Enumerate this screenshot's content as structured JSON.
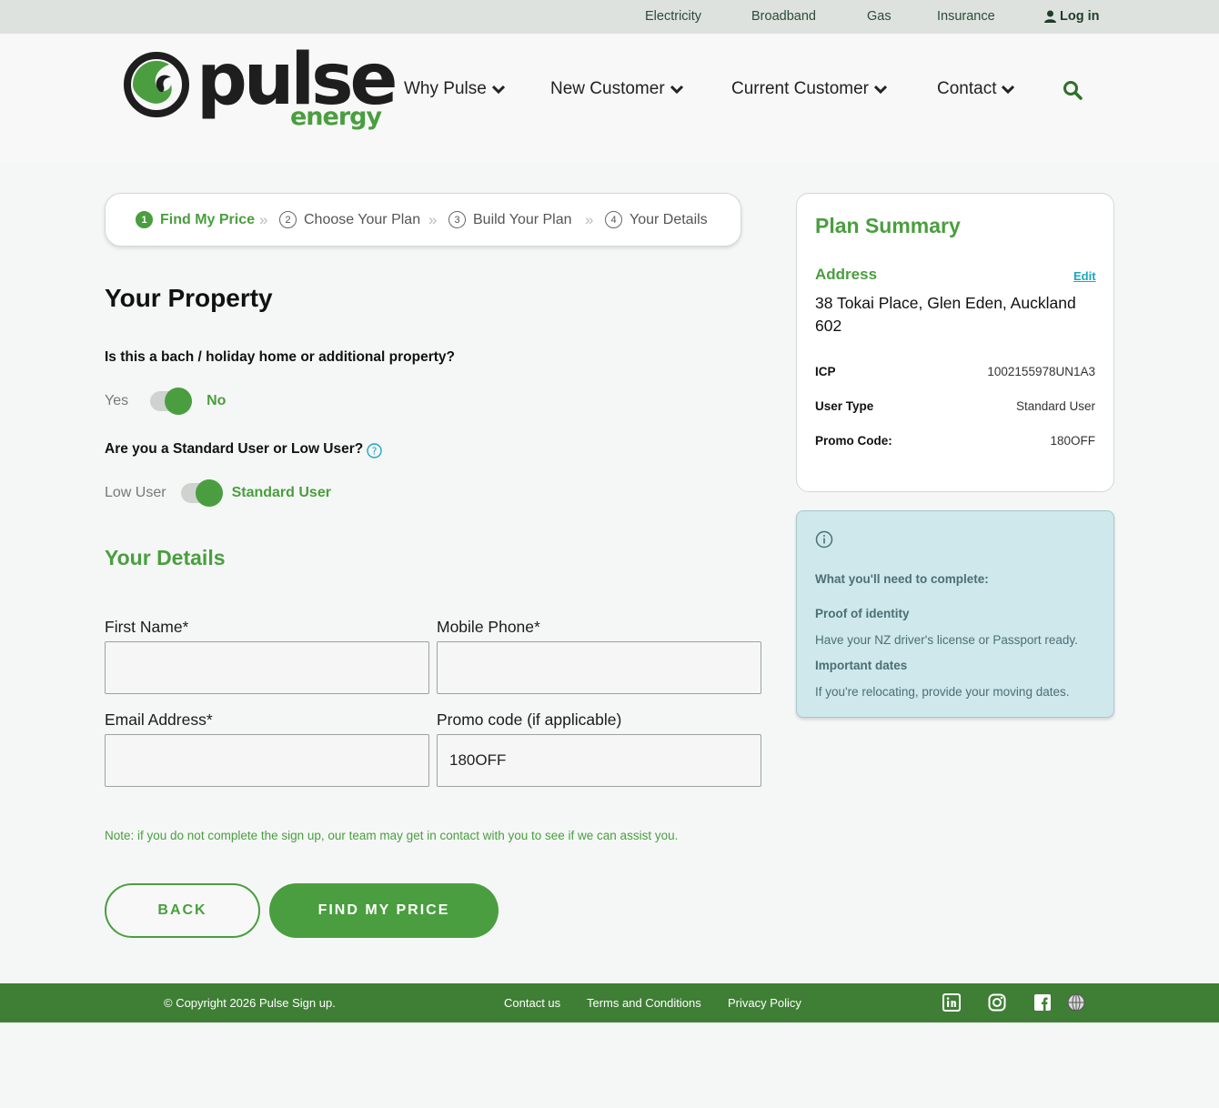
{
  "topbar": {
    "links": [
      "Electricity",
      "Broadband",
      "Gas",
      "Insurance"
    ],
    "login": "Log in",
    "login_icon": "user-icon"
  },
  "brand": {
    "word": "pulse",
    "sub": "energy",
    "primary": "#4a9e3f",
    "dark": "#1e1e1e"
  },
  "nav": {
    "items": [
      "Why Pulse",
      "New Customer",
      "Current Customer",
      "Contact"
    ],
    "search_icon": "search-icon"
  },
  "stepper": {
    "steps": [
      {
        "num": "1",
        "label": "Find My Price"
      },
      {
        "num": "2",
        "label": "Choose Your Plan"
      },
      {
        "num": "3",
        "label": "Build Your Plan"
      },
      {
        "num": "4",
        "label": "Your Details"
      }
    ],
    "separator": "»"
  },
  "property": {
    "title": "Your Property",
    "q1": "Is this a bach / holiday home or additional property?",
    "q1_off": "Yes",
    "q1_on": "No",
    "q2": "Are you a Standard User or Low User?",
    "q2_off": "Low User",
    "q2_on": "Standard User"
  },
  "details": {
    "title": "Your Details",
    "first_name_label": "First Name*",
    "first_name_value": "",
    "mobile_label": "Mobile Phone*",
    "mobile_value": "",
    "email_label": "Email Address*",
    "email_value": "",
    "promo_label": "Promo code (if applicable)",
    "promo_value": "180OFF",
    "note": "Note: if you do not complete the sign up, our team may get in contact with you to see if we can assist you.",
    "back": "BACK",
    "find": "FIND MY PRICE"
  },
  "summary": {
    "title": "Plan Summary",
    "address_label": "Address",
    "edit": "Edit",
    "address": "38 Tokai Place, Glen Eden, Auckland 602",
    "icp_label": "ICP",
    "icp_value": "1002155978UN1A3",
    "user_type_label": "User Type",
    "user_type_value": "Standard User",
    "promo_label": "Promo Code:",
    "promo_value": "180OFF"
  },
  "info": {
    "heading": "What you'll need to complete:",
    "item1_title": "Proof of identity",
    "item1_text": "Have your NZ driver's license or Passport ready.",
    "item2_title": "Important dates",
    "item2_text": "If you're relocating, provide your moving dates."
  },
  "footer": {
    "copyright": "© Copyright 2026 Pulse Sign up.",
    "links": [
      "Contact us",
      "Terms and Conditions",
      "Privacy Policy"
    ],
    "social": [
      "linkedin-icon",
      "instagram-icon",
      "facebook-icon",
      "globe-icon"
    ]
  }
}
